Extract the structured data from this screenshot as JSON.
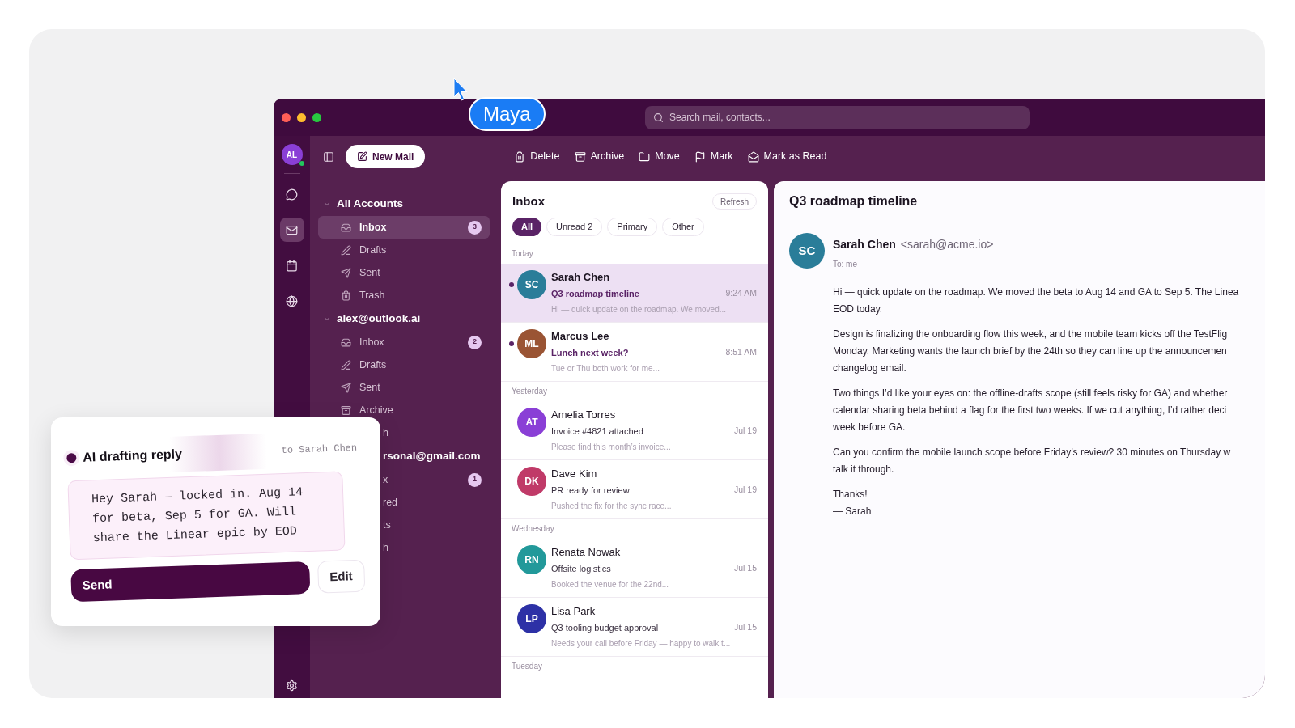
{
  "cursor": {
    "label": "Maya"
  },
  "window": {
    "search": {
      "placeholder": "Search mail, contacts..."
    }
  },
  "rail": {
    "avatar": "AL",
    "online": true,
    "items": [
      {
        "kind": "chat",
        "selected": false
      },
      {
        "kind": "mail",
        "selected": true
      },
      {
        "kind": "calendar",
        "selected": false
      },
      {
        "kind": "globe",
        "selected": false
      }
    ]
  },
  "toolbar": {
    "new_mail": "New Mail",
    "actions": [
      {
        "kind": "delete",
        "label": "Delete"
      },
      {
        "kind": "archive",
        "label": "Archive"
      },
      {
        "kind": "move",
        "label": "Move"
      },
      {
        "kind": "mark",
        "label": "Mark"
      },
      {
        "kind": "read",
        "label": "Mark as Read"
      }
    ]
  },
  "folders": [
    {
      "account": "All Accounts",
      "expanded": true,
      "items": [
        {
          "kind": "inbox",
          "label": "Inbox",
          "badge": "3",
          "selected": true
        },
        {
          "kind": "drafts",
          "label": "Drafts",
          "selected": false
        },
        {
          "kind": "sent",
          "label": "Sent",
          "selected": false
        },
        {
          "kind": "trash",
          "label": "Trash",
          "selected": false
        }
      ]
    },
    {
      "account": "alex@outlook.ai",
      "expanded": true,
      "items": [
        {
          "kind": "inbox",
          "label": "Inbox",
          "badge": "2",
          "selected": false
        },
        {
          "kind": "drafts",
          "label": "Drafts",
          "selected": false
        },
        {
          "kind": "sent",
          "label": "Sent",
          "selected": false
        },
        {
          "kind": "archive",
          "label": "Archive",
          "selected": false
        },
        {
          "kind": "fragment",
          "label": "h",
          "selected": false
        }
      ]
    },
    {
      "account": "rsonal@gmail.com",
      "kind": "fragment",
      "items": [
        {
          "kind": "fragment",
          "label": "x",
          "badge": "1",
          "selected": false
        },
        {
          "kind": "fragment",
          "label": "red",
          "selected": false
        },
        {
          "kind": "fragment",
          "label": "ts",
          "selected": false
        },
        {
          "kind": "fragment",
          "label": "h",
          "selected": false
        }
      ]
    }
  ],
  "message_list": {
    "title": "Inbox",
    "refresh": "Refresh",
    "filters": [
      {
        "label": "All",
        "selected": true
      },
      {
        "label": "Unread 2",
        "selected": false
      },
      {
        "label": "Primary",
        "selected": false
      },
      {
        "label": "Other",
        "selected": false
      }
    ],
    "groups": [
      {
        "label": "Today",
        "messages": [
          {
            "initials": "SC",
            "color": "#2a7d99",
            "sender": "Sarah Chen",
            "subject": "Q3 roadmap timeline",
            "time": "9:24 AM",
            "preview": "Hi — quick update on the roadmap. We moved...",
            "unread": true,
            "selected": true
          },
          {
            "initials": "ML",
            "color": "#9a5434",
            "sender": "Marcus Lee",
            "subject": "Lunch next week?",
            "time": "8:51 AM",
            "preview": "Tue or Thu both work for me...",
            "unread": true,
            "selected": false
          }
        ]
      },
      {
        "label": "Yesterday",
        "messages": [
          {
            "initials": "AT",
            "color": "#8a3fd6",
            "sender": "Amelia Torres",
            "subject": "Invoice #4821 attached",
            "time": "Jul 19",
            "preview": "Please find this month’s invoice...",
            "unread": false,
            "selected": false
          },
          {
            "initials": "DK",
            "color": "#c03a68",
            "sender": "Dave Kim",
            "subject": "PR ready for review",
            "time": "Jul 19",
            "preview": "Pushed the fix for the sync race...",
            "unread": false,
            "selected": false
          }
        ]
      },
      {
        "label": "Wednesday",
        "messages": [
          {
            "initials": "RN",
            "color": "#22999a",
            "sender": "Renata Nowak",
            "subject": "Offsite logistics",
            "time": "Jul 15",
            "preview": "Booked the venue for the 22nd...",
            "unread": false,
            "selected": false
          },
          {
            "initials": "LP",
            "color": "#2d31a6",
            "sender": "Lisa Park",
            "subject": "Q3 tooling budget approval",
            "time": "Jul 15",
            "preview": "Needs your call before Friday — happy to walk t...",
            "unread": false,
            "selected": false
          }
        ]
      },
      {
        "label": "Tuesday"
      }
    ]
  },
  "reading_pane": {
    "subject": "Q3 roadmap timeline",
    "initials": "SC",
    "color": "#2a7d99",
    "sender": "Sarah Chen",
    "email": "<sarah@acme.io>",
    "to": "To: me",
    "paragraphs": [
      [
        "Hi — quick update on the roadmap. We moved the beta to Aug 14 and GA to Sep 5. The Linea",
        "EOD today."
      ],
      [
        "Design is finalizing the onboarding flow this week, and the mobile team kicks off the TestFlig",
        "Monday. Marketing wants the launch brief by the 24th so they can line up the announcemen",
        "changelog email."
      ],
      [
        "Two things I’d like your eyes on: the offline-drafts scope (still feels risky for GA) and whether",
        "calendar sharing beta behind a flag for the first two weeks. If we cut anything, I’d rather deci",
        "week before GA."
      ],
      [
        "Can you confirm the mobile launch scope before Friday’s review? 30 minutes on Thursday w",
        "talk it through."
      ],
      [
        "Thanks!",
        "— Sarah"
      ]
    ]
  },
  "ai_card": {
    "title": "AI drafting reply",
    "to": "to Sarah Chen",
    "draft": "Hey Sarah — locked in. Aug 14 for beta, Sep 5 for GA. Will share the Linear epic by EOD",
    "send": "Send",
    "edit": "Edit"
  }
}
